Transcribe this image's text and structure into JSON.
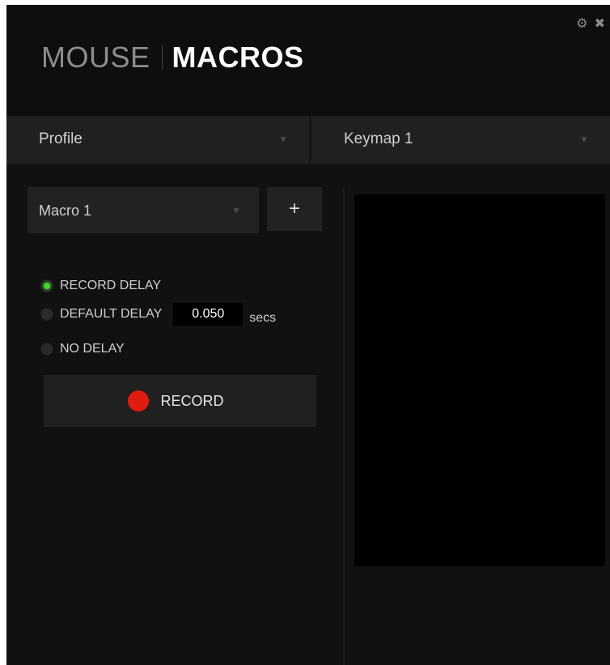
{
  "header": {
    "breadcrumb": "MOUSE",
    "title": "MACROS",
    "settings_icon": "gear-icon",
    "close_icon": "close-icon"
  },
  "selectors": {
    "profile": "Profile",
    "keymap": "Keymap 1"
  },
  "macro": {
    "selected": "Macro 1",
    "add_label": "+"
  },
  "delay_options": {
    "record_delay": "RECORD DELAY",
    "default_delay": "DEFAULT DELAY",
    "default_delay_value": "0.050",
    "default_delay_unit": "secs",
    "no_delay": "NO DELAY",
    "selected": "RECORD DELAY"
  },
  "record_button": {
    "label": "RECORD"
  },
  "colors": {
    "accent": "#44d62c",
    "record": "#e01b0f"
  }
}
